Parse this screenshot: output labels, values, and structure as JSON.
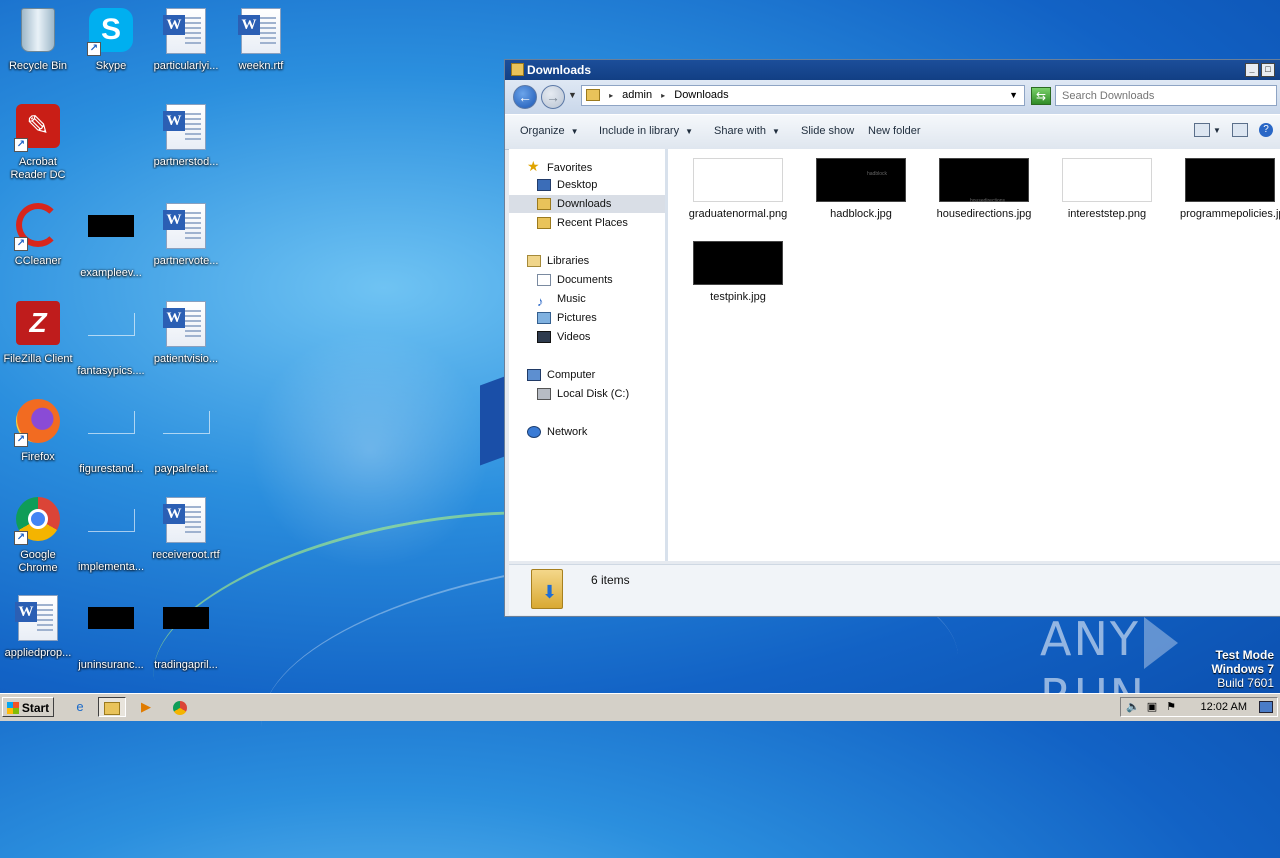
{
  "desktop": {
    "icons": [
      {
        "label": "Recycle Bin"
      },
      {
        "label": "Skype"
      },
      {
        "label": "particularlyi..."
      },
      {
        "label": "weekn.rtf"
      },
      {
        "label": "Acrobat Reader DC"
      },
      {
        "label": "partnerstod..."
      },
      {
        "label": "CCleaner"
      },
      {
        "label": "exampleev..."
      },
      {
        "label": "partnervote..."
      },
      {
        "label": "FileZilla Client"
      },
      {
        "label": "fantasypics...."
      },
      {
        "label": "patientvisio..."
      },
      {
        "label": "Firefox"
      },
      {
        "label": "figurestand..."
      },
      {
        "label": "paypalrelat..."
      },
      {
        "label": "Google Chrome"
      },
      {
        "label": "implementa..."
      },
      {
        "label": "receiveroot.rtf"
      },
      {
        "label": "appliedprop..."
      },
      {
        "label": "juninsuranc..."
      },
      {
        "label": "tradingapril..."
      }
    ]
  },
  "window": {
    "title": "Downloads",
    "breadcrumb": [
      "admin",
      "Downloads"
    ],
    "search_placeholder": "Search Downloads",
    "commands": [
      "Organize",
      "Include in library",
      "Share with",
      "Slide show",
      "New folder"
    ],
    "nav": {
      "favorites": "Favorites",
      "desktop": "Desktop",
      "downloads": "Downloads",
      "recent": "Recent Places",
      "libraries": "Libraries",
      "documents": "Documents",
      "music": "Music",
      "pictures": "Pictures",
      "videos": "Videos",
      "computer": "Computer",
      "localdisk": "Local Disk (C:)",
      "network": "Network"
    },
    "files": [
      {
        "name": "graduatenormal.png",
        "thumb_text": ""
      },
      {
        "name": "hadblock.jpg",
        "thumb_text": "hadblock"
      },
      {
        "name": "housedirections.jpg",
        "thumb_text": "housedirections"
      },
      {
        "name": "intereststep.png",
        "thumb_text": ""
      },
      {
        "name": "programmepolicies.jpg",
        "thumb_text": ""
      },
      {
        "name": "testpink.jpg",
        "thumb_text": ""
      }
    ],
    "status": "6 items"
  },
  "watermark": {
    "brand_left": "ANY",
    "brand_right": "RUN",
    "line1": "Test Mode",
    "line2": "Windows 7",
    "line3": "Build 7601"
  },
  "taskbar": {
    "start": "Start",
    "clock": "12:02 AM"
  },
  "colors": {
    "titlebar": "#1c4e9a",
    "wallpaper": "#1262c5"
  }
}
